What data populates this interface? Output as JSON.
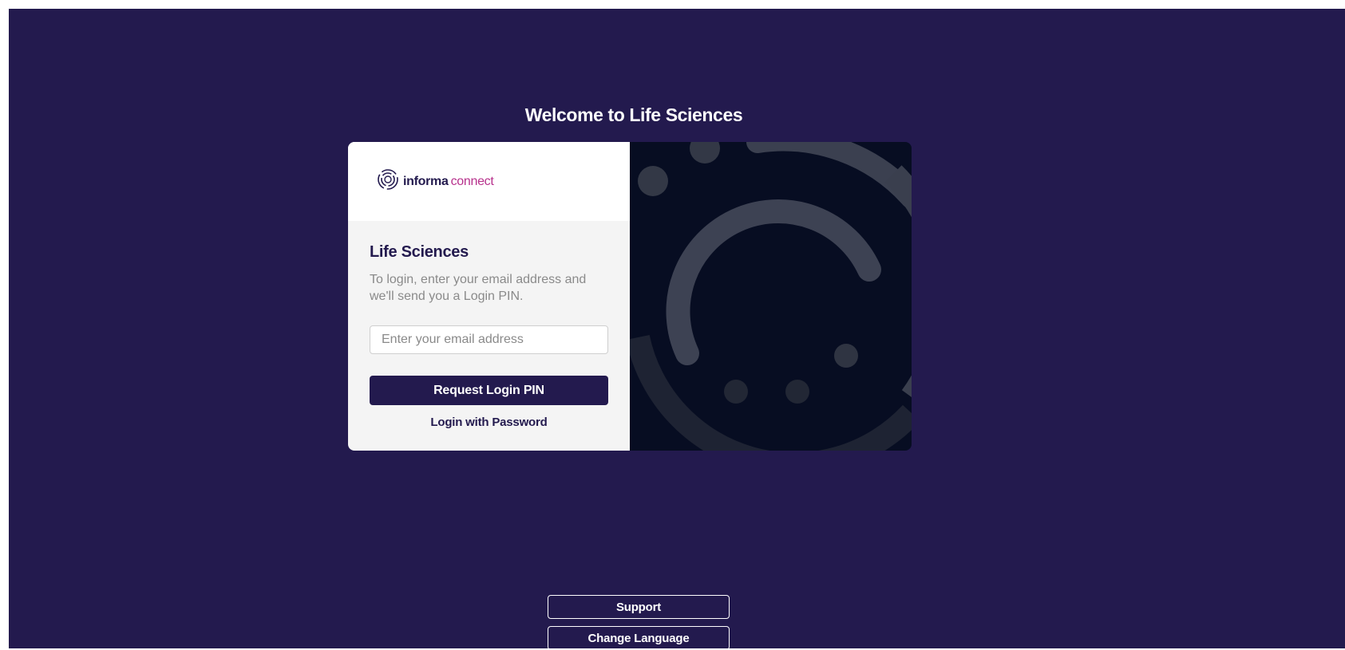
{
  "welcome_title": "Welcome to Life Sciences",
  "logo": {
    "part1": "informa",
    "part2": "connect"
  },
  "form": {
    "title": "Life Sciences",
    "description": "To login, enter your email address and we'll send you a Login PIN.",
    "email_placeholder": "Enter your email address",
    "request_pin_label": "Request Login PIN",
    "password_login_label": "Login with Password"
  },
  "footer": {
    "support_label": "Support",
    "language_label": "Change Language"
  },
  "colors": {
    "background": "#231a4e",
    "card_panel": "#f4f4f4",
    "graphic_panel": "#070d22",
    "brand_accent": "#b7318c"
  }
}
